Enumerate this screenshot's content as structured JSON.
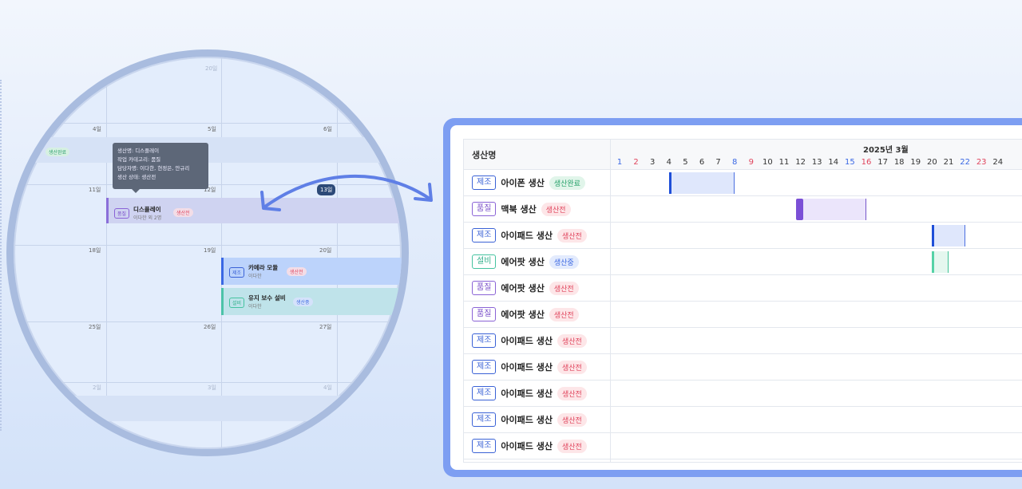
{
  "calendar": {
    "row1_days": [
      "20일"
    ],
    "week1": {
      "d1": "4일",
      "d2": "5일",
      "d3": "6일"
    },
    "week2": {
      "d1": "11일",
      "d2": "12일",
      "d3": "13일"
    },
    "week3": {
      "d1": "18일",
      "d2": "19일",
      "d3": "20일"
    },
    "week4": {
      "d1": "25일",
      "d2": "26일",
      "d3": "27일"
    },
    "week5": {
      "d1": "2일",
      "d2": "3일",
      "d3": "4일"
    },
    "done_badge": "생산완료",
    "tooltip": {
      "line1": "생산명: 디스플레이",
      "line2": "작업 카테고리: 품질",
      "line3": "담당자명: 이다한, 현정은, 안규리",
      "line4": "생산 상태: 생산전"
    },
    "ev_display": {
      "tag": "품질",
      "title": "디스플레이",
      "sub": "이다한 외 2명",
      "badge": "생산전"
    },
    "ev_camera": {
      "tag": "제조",
      "title": "카메라 모듈",
      "sub": "이다한",
      "badge": "생산전"
    },
    "ev_maint": {
      "tag": "설비",
      "title": "유지 보수 설비",
      "sub": "이다한",
      "badge": "생산중"
    }
  },
  "gantt": {
    "name_header": "생산명",
    "month_label": "2025년 3월",
    "days": [
      {
        "n": "1",
        "k": "sat"
      },
      {
        "n": "2",
        "k": "sun"
      },
      {
        "n": "3",
        "k": ""
      },
      {
        "n": "4",
        "k": ""
      },
      {
        "n": "5",
        "k": ""
      },
      {
        "n": "6",
        "k": ""
      },
      {
        "n": "7",
        "k": ""
      },
      {
        "n": "8",
        "k": "sat"
      },
      {
        "n": "9",
        "k": "sun"
      },
      {
        "n": "10",
        "k": ""
      },
      {
        "n": "11",
        "k": ""
      },
      {
        "n": "12",
        "k": ""
      },
      {
        "n": "13",
        "k": ""
      },
      {
        "n": "14",
        "k": ""
      },
      {
        "n": "15",
        "k": "sat"
      },
      {
        "n": "16",
        "k": "sun"
      },
      {
        "n": "17",
        "k": ""
      },
      {
        "n": "18",
        "k": ""
      },
      {
        "n": "19",
        "k": ""
      },
      {
        "n": "20",
        "k": ""
      },
      {
        "n": "21",
        "k": ""
      },
      {
        "n": "22",
        "k": "sat"
      },
      {
        "n": "23",
        "k": "sun"
      },
      {
        "n": "24",
        "k": ""
      }
    ],
    "rows": [
      {
        "tag": "제조",
        "tagType": "mfg",
        "name": "아이폰 생산",
        "status": "생산완료",
        "statusType": "done",
        "bar": {
          "start": 4,
          "end": 8,
          "color": "blue"
        }
      },
      {
        "tag": "품질",
        "tagType": "qc",
        "name": "맥북 생산",
        "status": "생산전",
        "statusType": "before",
        "bar": {
          "start": 12,
          "end": 16,
          "color": "purple"
        }
      },
      {
        "tag": "제조",
        "tagType": "mfg",
        "name": "아이패드 생산",
        "status": "생산전",
        "statusType": "before",
        "bar": {
          "start": 20,
          "end": 22,
          "color": "blue"
        }
      },
      {
        "tag": "설비",
        "tagType": "eq",
        "name": "에어팟 생산",
        "status": "생산중",
        "statusType": "inprog",
        "bar": {
          "start": 20,
          "end": 21,
          "color": "teal"
        }
      },
      {
        "tag": "품질",
        "tagType": "qc",
        "name": "에어팟 생산",
        "status": "생산전",
        "statusType": "before"
      },
      {
        "tag": "품질",
        "tagType": "qc",
        "name": "에어팟 생산",
        "status": "생산전",
        "statusType": "before"
      },
      {
        "tag": "제조",
        "tagType": "mfg",
        "name": "아이패드 생산",
        "status": "생산전",
        "statusType": "before"
      },
      {
        "tag": "제조",
        "tagType": "mfg",
        "name": "아이패드 생산",
        "status": "생산전",
        "statusType": "before"
      },
      {
        "tag": "제조",
        "tagType": "mfg",
        "name": "아이패드 생산",
        "status": "생산전",
        "statusType": "before"
      },
      {
        "tag": "제조",
        "tagType": "mfg",
        "name": "아이패드 생산",
        "status": "생산전",
        "statusType": "before"
      },
      {
        "tag": "제조",
        "tagType": "mfg",
        "name": "아이패드 생산",
        "status": "생산전",
        "statusType": "before"
      }
    ]
  }
}
